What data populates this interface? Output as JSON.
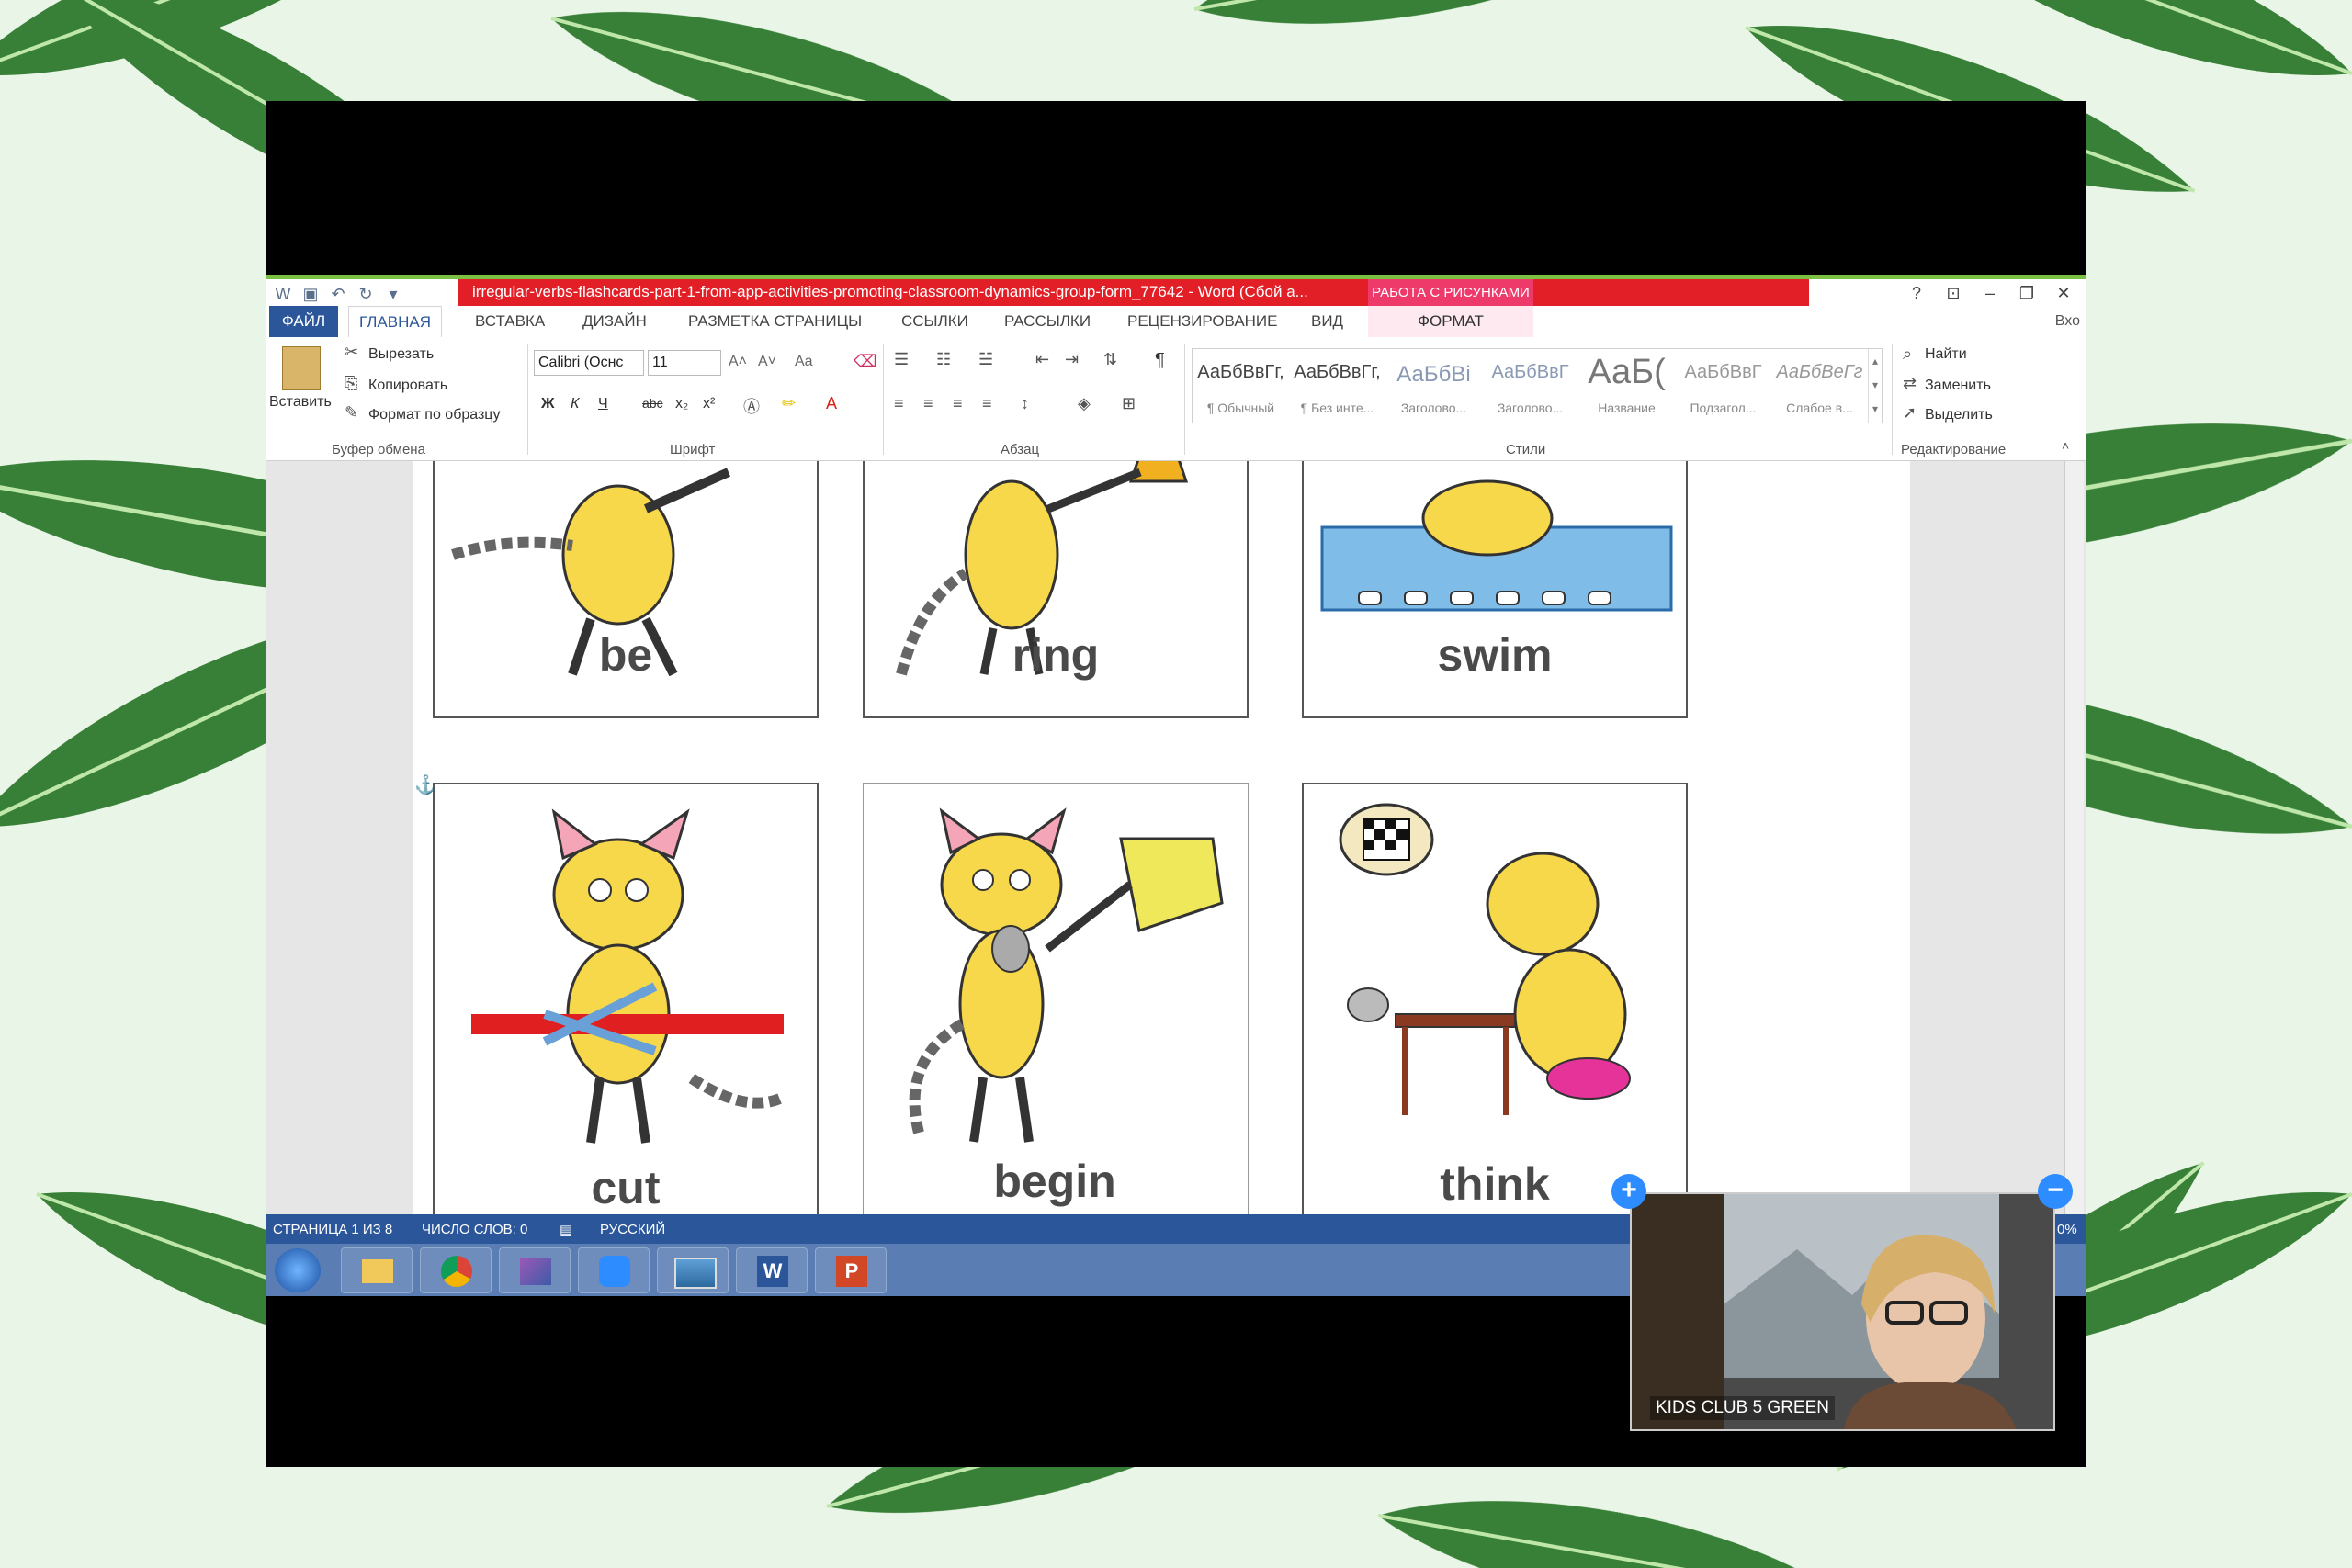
{
  "titlebar": {
    "document_title": "irregular-verbs-flashcards-part-1-from-app-activities-promoting-classroom-dynamics-group-form_77642 - Word (Сбой а...",
    "picture_tools": "РАБОТА С РИСУНКАМИ",
    "help": "?"
  },
  "tabs": {
    "file": "ФАЙЛ",
    "home": "ГЛАВНАЯ",
    "insert": "ВСТАВКА",
    "design": "ДИЗАЙН",
    "layout": "РАЗМЕТКА СТРАНИЦЫ",
    "references": "ССЫЛКИ",
    "mailings": "РАССЫЛКИ",
    "review": "РЕЦЕНЗИРОВАНИЕ",
    "view": "ВИД",
    "format": "ФОРМАТ",
    "signin": "Вхо"
  },
  "ribbon": {
    "clipboard": {
      "paste": "Вставить",
      "cut": "Вырезать",
      "copy": "Копировать",
      "format_painter": "Формат по образцу",
      "group": "Буфер обмена"
    },
    "font": {
      "name": "Calibri (Оснс",
      "size": "11",
      "grow": "A˄",
      "shrink": "A˅",
      "case": "Aa",
      "bold": "Ж",
      "italic": "К",
      "underline": "Ч",
      "strike": "abc",
      "subscript": "x₂",
      "superscript": "x²",
      "group": "Шрифт"
    },
    "paragraph": {
      "group": "Абзац",
      "pilcrow": "¶"
    },
    "styles": {
      "group": "Стили",
      "items": [
        {
          "sample": "АаБбВвГг,",
          "name": "¶ Обычный"
        },
        {
          "sample": "АаБбВвГг,",
          "name": "¶ Без инте..."
        },
        {
          "sample": "АаБбВі",
          "name": "Заголово..."
        },
        {
          "sample": "АаБбВвГ",
          "name": "Заголово..."
        },
        {
          "sample": "АаБ(",
          "name": "Название"
        },
        {
          "sample": "АаБбВвГ",
          "name": "Подзагол..."
        },
        {
          "sample": "АаБбВеГг",
          "name": "Слабое в..."
        }
      ]
    },
    "editing": {
      "find": "Найти",
      "replace": "Заменить",
      "select": "Выделить",
      "group": "Редактирование"
    }
  },
  "cards": [
    {
      "word": "be"
    },
    {
      "word": "ring"
    },
    {
      "word": "swim"
    },
    {
      "word": "cut"
    },
    {
      "word": "begin"
    },
    {
      "word": "think"
    }
  ],
  "statusbar": {
    "page": "СТРАНИЦА 1 ИЗ 8",
    "words": "ЧИСЛО СЛОВ: 0",
    "language": "РУССКИЙ",
    "zoom_tail": "0%"
  },
  "video": {
    "label": "KIDS CLUB 5 GREEN"
  }
}
